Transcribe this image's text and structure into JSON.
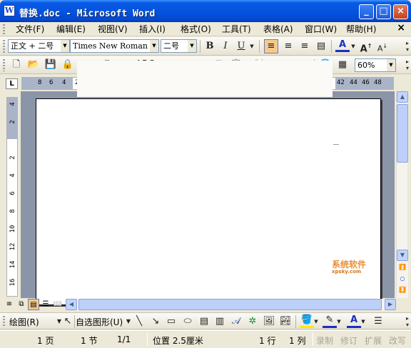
{
  "window": {
    "title": "替换.doc - Microsoft Word",
    "minimize": "_",
    "maximize": "□",
    "close": "×"
  },
  "menu": {
    "items": [
      "文件(F)",
      "编辑(E)",
      "视图(V)",
      "插入(I)",
      "格式(O)",
      "工具(T)",
      "表格(A)",
      "窗口(W)",
      "帮助(H)"
    ],
    "doc_close": "×"
  },
  "format_toolbar": {
    "style": "正文 + 二号",
    "font": "Times New Roman",
    "size": "二号",
    "bold": "B",
    "italic": "I",
    "underline": "U",
    "font_color_letter": "A",
    "grow_font": "A",
    "shrink_font": "A"
  },
  "standard_toolbar": {
    "zoom": "60%"
  },
  "ruler": {
    "left_ticks": [
      "8",
      "6",
      "4",
      "2"
    ],
    "right_ticks": [
      "42",
      "44",
      "46",
      "48"
    ],
    "vertical_ticks": [
      "4",
      "2",
      "2",
      "4",
      "6",
      "8",
      "10",
      "12",
      "14",
      "16"
    ],
    "tab_marker": "L"
  },
  "watermark": {
    "text": "系统软件",
    "subtext": "xpsky.com"
  },
  "draw_toolbar": {
    "draw": "绘图(R)",
    "autoshapes": "自选图形(U)"
  },
  "status": {
    "page": "1 页",
    "section": "1 节",
    "page_of": "1/1",
    "position": "位置 2.5厘米",
    "line": "1 行",
    "column": "1 列",
    "rec": "录制",
    "trk": "修订",
    "ext": "扩展",
    "ovr": "改写"
  },
  "colors": {
    "title_bar": "#0454e0",
    "menu_bg": "#ece9d8",
    "active_button": "#f7c98a",
    "doc_background": "#8b95a8"
  }
}
